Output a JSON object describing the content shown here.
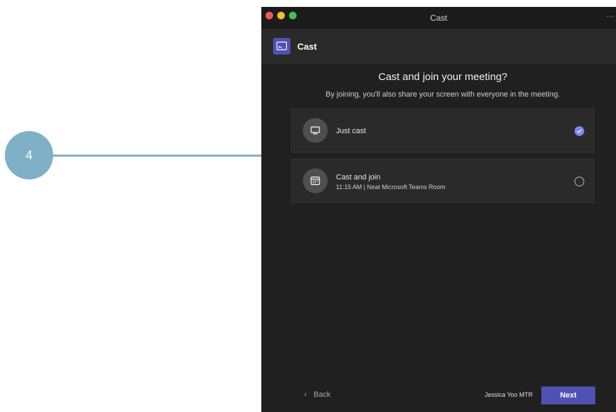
{
  "callout": {
    "number": "4",
    "color": "#7fb0c8"
  },
  "window": {
    "title": "Cast",
    "more_icon": "more-icon",
    "app_bar": {
      "icon": "cast-icon",
      "title": "Cast",
      "accent": "#4f52b2"
    },
    "headline": "Cast and join your meeting?",
    "subline": "By joining, you'll also share your screen with everyone in the meeting.",
    "options": [
      {
        "label": "Just cast",
        "icon": "monitor-icon",
        "selected": true
      },
      {
        "label": "Cast and join",
        "sublabel": "11:15 AM | Neat Microsoft Teams Room",
        "icon": "calendar-icon",
        "selected": false
      }
    ],
    "footer": {
      "back_label": "Back",
      "user_name": "Jessica Yoo MTR",
      "next_label": "Next"
    }
  }
}
